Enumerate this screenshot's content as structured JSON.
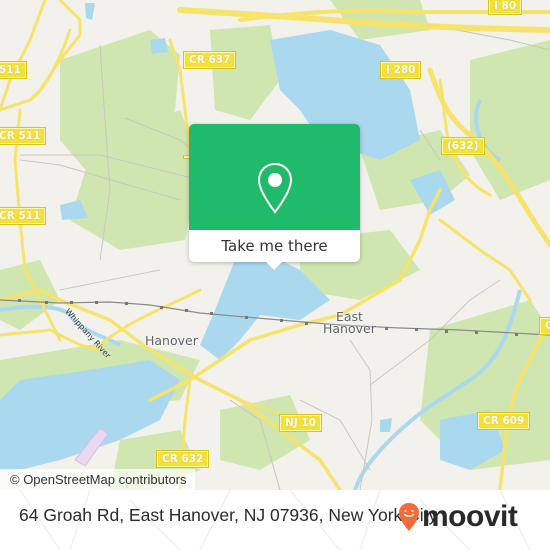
{
  "map": {
    "attribution": "© OpenStreetMap contributors",
    "colors": {
      "land": "#f2f1ec",
      "water": "#a9d8ef",
      "park": "#cfe6b0",
      "road_major": "#f7e36b",
      "road_minor": "#c9c6c0",
      "rail": "#777777"
    },
    "road_shields": [
      {
        "id": "cr511-top",
        "label": "511"
      },
      {
        "id": "cr511-mid",
        "label": "CR 511"
      },
      {
        "id": "cr511-low",
        "label": "CR 511"
      },
      {
        "id": "cr637",
        "label": "CR 637"
      },
      {
        "id": "i280",
        "label": "I 280"
      },
      {
        "id": "i80",
        "label": "I 80"
      },
      {
        "id": "r632-paren",
        "label": "(632)"
      },
      {
        "id": "nj10",
        "label": "NJ 10"
      },
      {
        "id": "cr609",
        "label": "CR 609"
      },
      {
        "id": "cr632",
        "label": "CR 632"
      },
      {
        "id": "edge-right",
        "label": "C"
      }
    ],
    "places": [
      {
        "id": "hanover",
        "label": "Hanover"
      },
      {
        "id": "east-hanover",
        "label": "East\nHanover"
      }
    ],
    "river_label": "Whippany River"
  },
  "popup": {
    "icon": "map-pin-icon",
    "button_label": "Take me there",
    "color": "#1fba6a"
  },
  "footer": {
    "address": "64 Groah Rd, East Hanover, NJ 07936, New York City",
    "logo_text": "moovit",
    "logo_icon": "moovit-pin-icon",
    "logo_color": "#f26b3a"
  }
}
